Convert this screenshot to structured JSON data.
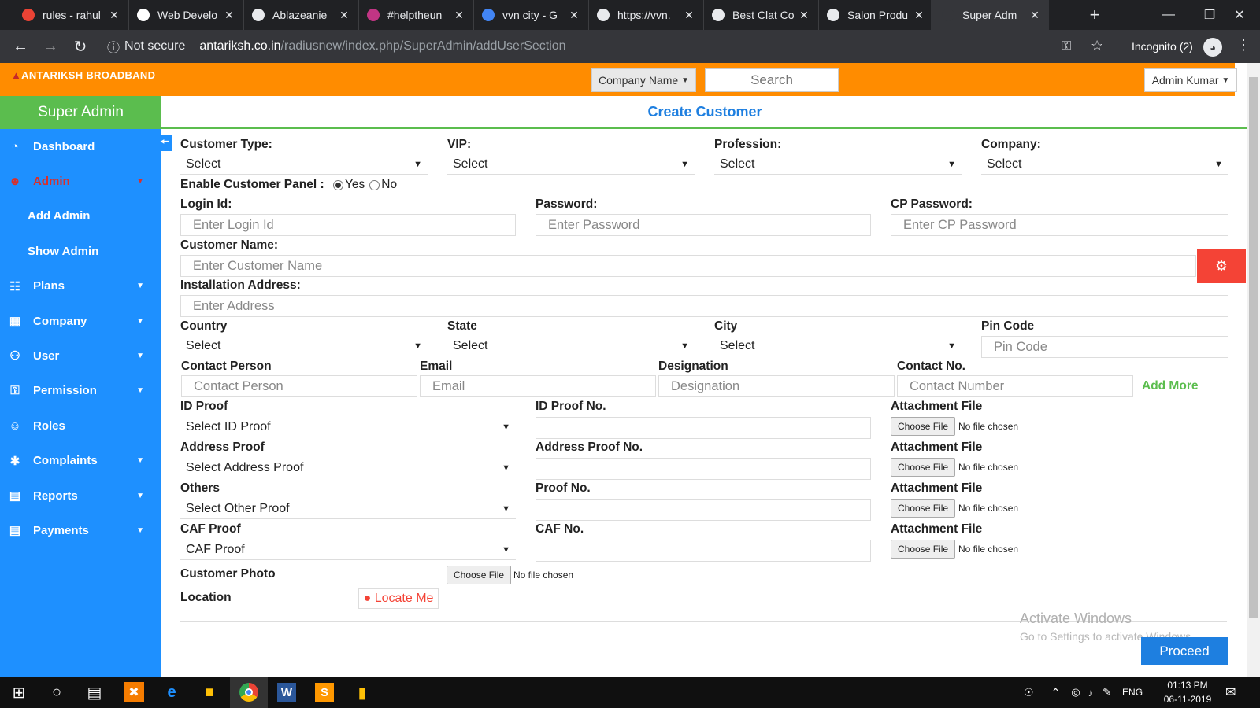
{
  "browser": {
    "tabs": [
      {
        "title": "rules - rahul",
        "icon": "gmail-icon",
        "color": "#ea4335"
      },
      {
        "title": "Web Develo",
        "icon": "dev-icon",
        "color": "#ffffff"
      },
      {
        "title": "Ablazeanie",
        "icon": "globe-icon",
        "color": "#e8eaed"
      },
      {
        "title": "#helptheun",
        "icon": "instagram-icon",
        "color": "#c13584"
      },
      {
        "title": "vvn city - G",
        "icon": "google-icon",
        "color": "#4285f4"
      },
      {
        "title": "https://vvn.",
        "icon": "globe-icon",
        "color": "#e8eaed"
      },
      {
        "title": "Best Clat Co",
        "icon": "globe-icon",
        "color": "#e8eaed"
      },
      {
        "title": "Salon Produ",
        "icon": "globe-icon",
        "color": "#e8eaed"
      },
      {
        "title": "Super Adm",
        "icon": "blank-icon",
        "color": "#35363a"
      }
    ],
    "not_secure": "Not secure",
    "url_host": "antariksh.co.in",
    "url_path": "/radiusnew/index.php/SuperAdmin/addUserSection",
    "incognito": "Incognito (2)"
  },
  "header": {
    "logo": "ANTARIKSH BROADBAND",
    "company_dropdown": "Company Name",
    "search_placeholder": "Search",
    "admin_dropdown": "Admin Kumar"
  },
  "sidebar": {
    "title": "Super Admin",
    "items": [
      {
        "label": "Dashboard",
        "icon": "dashboard-icon",
        "caret": false
      },
      {
        "label": "Admin",
        "icon": "admin-icon",
        "caret": true,
        "active": true
      },
      {
        "label": "Add Admin",
        "sub": true
      },
      {
        "label": "Show Admin",
        "sub": true
      },
      {
        "label": "Plans",
        "icon": "sitemap-icon",
        "caret": true
      },
      {
        "label": "Company",
        "icon": "building-icon",
        "caret": true
      },
      {
        "label": "User",
        "icon": "users-icon",
        "caret": true
      },
      {
        "label": "Permission",
        "icon": "key-icon",
        "caret": true
      },
      {
        "label": "Roles",
        "icon": "user-icon",
        "caret": false
      },
      {
        "label": "Complaints",
        "icon": "bug-icon",
        "caret": true
      },
      {
        "label": "Reports",
        "icon": "file-icon",
        "caret": true
      },
      {
        "label": "Payments",
        "icon": "file-icon",
        "caret": true
      }
    ]
  },
  "form": {
    "title": "Create Customer",
    "customer_type_label": "Customer Type:",
    "vip_label": "VIP:",
    "profession_label": "Profession:",
    "company_label": "Company:",
    "select": "Select",
    "enable_panel_label": "Enable Customer Panel :",
    "yes": "Yes",
    "no": "No",
    "login_id_label": "Login Id:",
    "login_id_placeholder": "Enter Login Id",
    "password_label": "Password:",
    "password_placeholder": "Enter Password",
    "cp_password_label": "CP Password:",
    "cp_password_placeholder": "Enter CP Password",
    "customer_name_label": "Customer Name:",
    "customer_name_placeholder": "Enter Customer Name",
    "address_label": "Installation Address:",
    "address_placeholder": "Enter Address",
    "country_label": "Country",
    "state_label": "State",
    "city_label": "City",
    "pin_label": "Pin Code",
    "pin_placeholder": "Pin Code",
    "contact_person_label": "Contact Person",
    "contact_person_placeholder": "Contact Person",
    "email_label": "Email",
    "email_placeholder": "Email",
    "designation_label": "Designation",
    "designation_placeholder": "Designation",
    "contact_no_label": "Contact No.",
    "contact_no_placeholder": "Contact Number",
    "add_more": "Add More",
    "id_proof_label": "ID Proof",
    "id_proof_select": "Select ID Proof",
    "id_proof_no_label": "ID Proof No.",
    "address_proof_label": "Address Proof",
    "address_proof_select": "Select Address Proof",
    "address_proof_no_label": "Address Proof No.",
    "others_label": "Others",
    "others_select": "Select Other Proof",
    "proof_no_label": "Proof No.",
    "caf_proof_label": "CAF Proof",
    "caf_proof_select": "CAF Proof",
    "caf_no_label": "CAF No.",
    "attachment_label": "Attachment File",
    "choose_file": "Choose File",
    "no_file": "No file chosen",
    "customer_photo_label": "Customer Photo",
    "location_label": "Location",
    "locate_me": "Locate Me",
    "proceed": "Proceed"
  },
  "watermark": {
    "line1": "Activate Windows",
    "line2": "Go to Settings to activate Windows."
  },
  "taskbar": {
    "lang": "ENG",
    "time": "01:13 PM",
    "date": "06-11-2019"
  },
  "colors": {
    "header": "#ff8c00",
    "sidebar": "#1e90ff",
    "accent_green": "#5bbd4e",
    "danger": "#f44336"
  }
}
